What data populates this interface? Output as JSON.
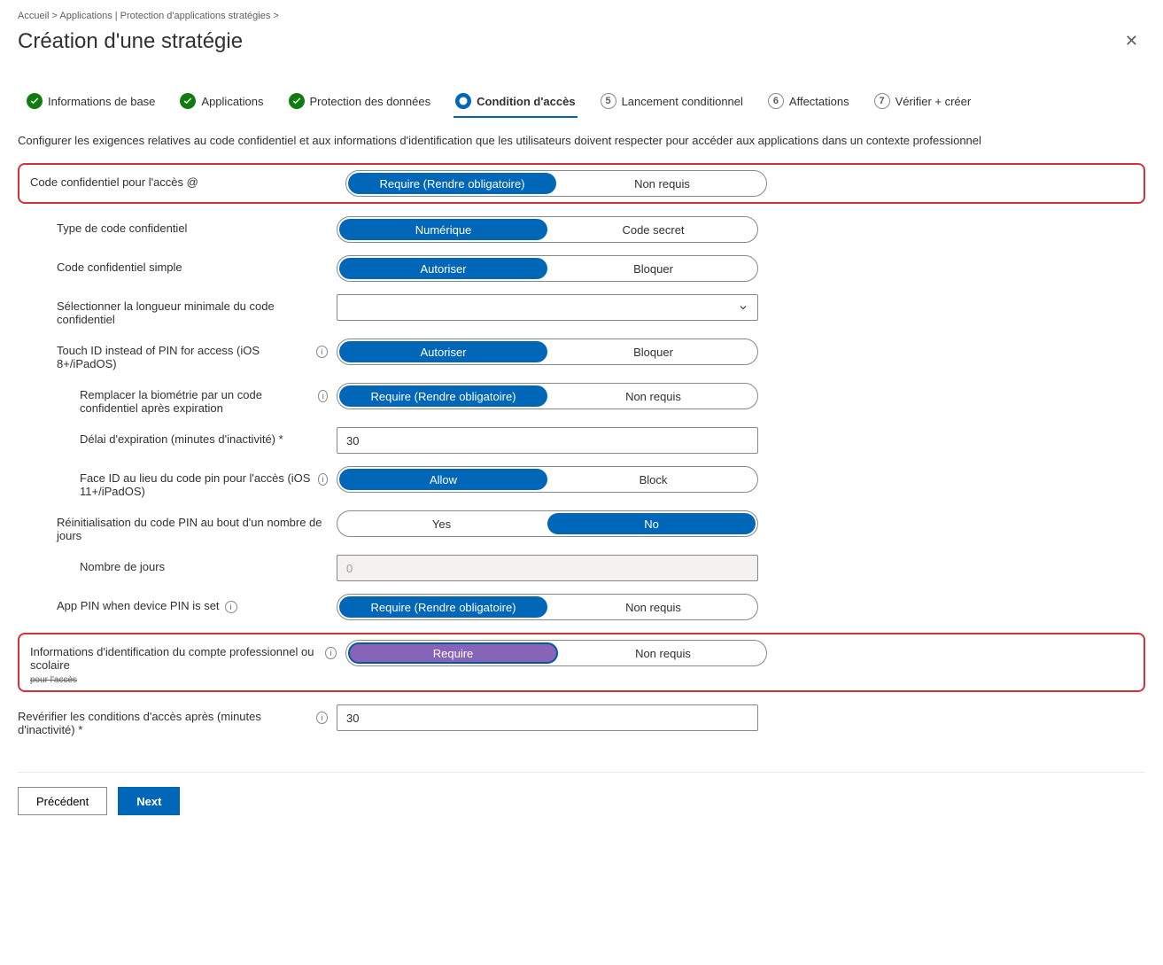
{
  "breadcrumb": "Accueil > Applications | Protection d'applications stratégies >",
  "page_title": "Création d'une stratégie",
  "tabs": {
    "t1": "Informations de base",
    "t2": "Applications",
    "t3": "Protection des données",
    "t4": "Condition d'accès",
    "t5_num": "5",
    "t5": "Lancement conditionnel",
    "t6_num": "6",
    "t6": "Affectations",
    "t7_num": "7",
    "t7": "Vérifier + créer"
  },
  "intro": "Configurer les exigences relatives au code confidentiel et aux informations d'identification que les utilisateurs doivent respecter pour accéder aux applications dans un contexte professionnel",
  "rows": {
    "pin_access": {
      "label": "Code confidentiel pour l'accès @",
      "opt1": "Require (Rendre obligatoire)",
      "opt2": "Non requis"
    },
    "pin_type": {
      "label": "Type de code confidentiel",
      "opt1": "Numérique",
      "opt2": "Code secret"
    },
    "simple_pin": {
      "label": "Code confidentiel simple",
      "opt1": "Autoriser",
      "opt2": "Bloquer"
    },
    "min_length": {
      "label": "Sélectionner la longueur minimale du code confidentiel",
      "value": ""
    },
    "touch_id": {
      "label": "Touch ID instead of PIN for access (iOS 8+/iPadOS)",
      "opt1": "Autoriser",
      "opt2": "Bloquer"
    },
    "override_bio": {
      "label": "Remplacer la biométrie par un code confidentiel après expiration",
      "opt1": "Require (Rendre obligatoire)",
      "opt2": "Non requis"
    },
    "timeout": {
      "label": "Délai d'expiration (minutes d'inactivité) *",
      "value": "30"
    },
    "face_id": {
      "label": "Face ID au lieu du code pin pour l'accès (iOS 11+/iPadOS)",
      "opt1": "Allow",
      "opt2": "Block"
    },
    "pin_reset": {
      "label": "Réinitialisation du code PIN au bout d'un nombre de jours",
      "opt1": "Yes",
      "opt2": "No"
    },
    "num_days": {
      "label": "Nombre de jours",
      "value": "0"
    },
    "app_pin": {
      "label": "App PIN when device PIN is set",
      "opt1": "Require (Rendre obligatoire)",
      "opt2": "Non requis"
    },
    "work_creds": {
      "label": "Informations d'identification du compte professionnel ou scolaire",
      "sublabel": "pour l'accès",
      "opt1": "Require",
      "opt2": "Non requis"
    },
    "recheck": {
      "label": "Revérifier les conditions d'accès après (minutes d'inactivité) *",
      "value": "30"
    }
  },
  "footer": {
    "prev": "Précédent",
    "next": "Next"
  }
}
